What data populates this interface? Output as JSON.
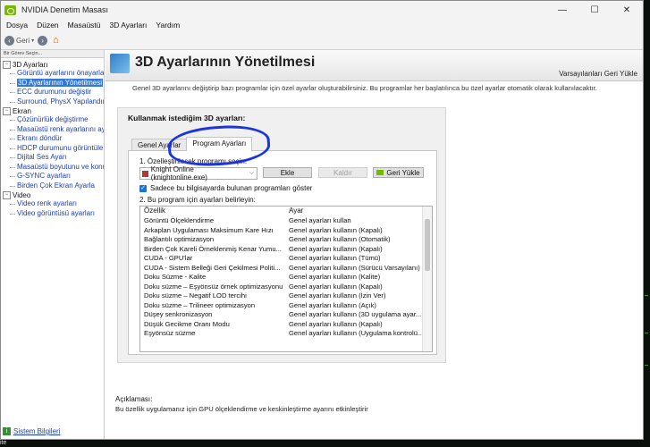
{
  "window": {
    "title": "NVIDIA Denetim Masası",
    "controls": [
      "—",
      "☐",
      "✕"
    ]
  },
  "menu": [
    "Dosya",
    "Düzen",
    "Masaüstü",
    "3D Ayarları",
    "Yardım"
  ],
  "toolbar": {
    "back_label": "Geri",
    "back_icon": "back-arrow-icon",
    "forward_icon": "forward-arrow-icon",
    "home_icon": "home-icon"
  },
  "sidebar": {
    "title": "Bir Görev Seçin...",
    "categories": [
      {
        "label": "3D Ayarları",
        "items": [
          {
            "label": "Görüntü ayarlarını önayarla y"
          },
          {
            "label": "3D Ayarlarının Yönetilmesi",
            "selected": true
          },
          {
            "label": "ECC durumunu değiştir"
          },
          {
            "label": "Surround, PhysX Yapılandırm"
          }
        ]
      },
      {
        "label": "Ekran",
        "items": [
          {
            "label": "Çözünürlük değiştirme"
          },
          {
            "label": "Masaüstü renk ayarlarını ayar"
          },
          {
            "label": "Ekranı döndür"
          },
          {
            "label": "HDCP durumunu görüntüle"
          },
          {
            "label": "Dijital Ses Ayarı"
          },
          {
            "label": "Masaüstü boyutunu ve konun"
          },
          {
            "label": "G-SYNC ayarları"
          },
          {
            "label": "Birden Çok Ekran Ayarla"
          }
        ]
      },
      {
        "label": "Video",
        "items": [
          {
            "label": "Video renk ayarları"
          },
          {
            "label": "Video görüntüsü ayarları"
          }
        ]
      }
    ],
    "footer": "Sistem Bilgileri"
  },
  "page": {
    "title": "3D Ayarlarının Yönetilmesi",
    "restore_defaults": "Varsayılanları Geri Yükle",
    "description": "Genel 3D ayarlarını değiştirip bazı programlar için özel ayarlar oluşturabilirsiniz. Bu programlar her başlatılınca bu özel ayarlar otomatik olarak kullanılacaktır.",
    "group_label": "Kullanmak istediğim 3D ayarları:",
    "tabs": [
      {
        "label": "Genel Ayarlar"
      },
      {
        "label": "Program Ayarları",
        "active": true
      }
    ],
    "step1_label": "1. Özelleştirilecek programı seçin:",
    "selected_program": "Knight Online (knightonline.exe)",
    "buttons": {
      "add": "Ekle",
      "remove": "Kaldır",
      "restore": "Geri Yükle"
    },
    "checkbox_label": "Sadece bu bilgisayarda bulunan programları göster",
    "checkbox_checked": true,
    "step2_label": "2. Bu program için ayarları belirleyin:",
    "grid": {
      "headers": [
        "Özellik",
        "Ayar"
      ],
      "rows": [
        [
          "Görüntü Ölçeklendirme",
          "Genel ayarları kullan"
        ],
        [
          "Arkaplan Uygulaması Maksimum Kare Hızı",
          "Genel ayarları kullanın (Kapalı)"
        ],
        [
          "Bağlantılı optimizasyon",
          "Genel ayarları kullanın (Otomatik)"
        ],
        [
          "Birden Çok Kareli Örneklenmiş Kenar Yumu...",
          "Genel ayarları kullanın (Kapalı)"
        ],
        [
          "CUDA - GPU'lar",
          "Genel ayarları kullanın (Tümü)"
        ],
        [
          "CUDA - Sistem Belleği Geri Çekilmesi Politi...",
          "Genel ayarları kullanın (Sürücü Varsayılanı)"
        ],
        [
          "Doku Süzme - Kalite",
          "Genel ayarları kullanın (Kalite)"
        ],
        [
          "Doku süzme – Eşyönsüz örnek optimizasyonu",
          "Genel ayarları kullanın (Kapalı)"
        ],
        [
          "Doku süzme – Negatif LOD tercihi",
          "Genel ayarları kullanın (İzin Ver)"
        ],
        [
          "Doku süzme – Trilineer optimizasyon",
          "Genel ayarları kullanın (Açık)"
        ],
        [
          "Düşey senkronizasyon",
          "Genel ayarları kullanın (3D uygulama ayar..."
        ],
        [
          "Düşük Gecikme Oranı Modu",
          "Genel ayarları kullanın (Kapalı)"
        ],
        [
          "Eşyönsüz süzme",
          "Genel ayarları kullanın (Uygulama kontrolü..."
        ]
      ]
    },
    "explanation_title": "Açıklaması:",
    "explanation_text": "Bu özellik uygulamanız için GPU ölçeklendirme ve keskinleştirme ayarını etkinleştirir"
  },
  "taskbar_fragment": "ite",
  "colors": {
    "nvidia_green": "#76b900",
    "selection_blue": "#3377d8",
    "annotation_blue": "#1a35e0",
    "link_blue": "#1a3fb0"
  }
}
